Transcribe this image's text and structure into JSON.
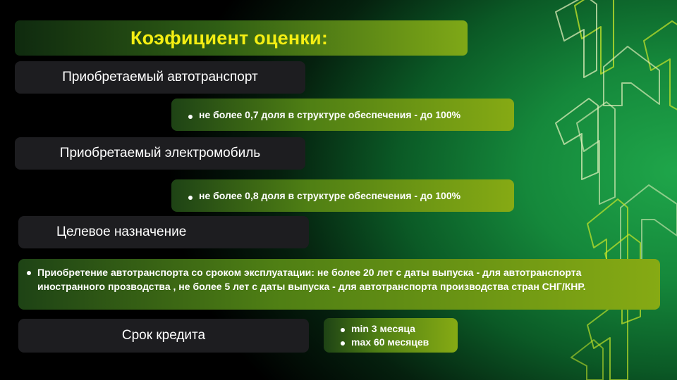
{
  "slide": {
    "title": "Коэфициент оценки:",
    "sections": [
      {
        "label": "Приобретаемый автотранспорт",
        "bullets": [
          "не более 0,7 доля в структуре обеспечения - до 100%"
        ]
      },
      {
        "label": "Приобретаемый электромобиль",
        "bullets": [
          "не более 0,8 доля в структуре обеспечения - до 100%"
        ]
      },
      {
        "label": "Целевое назначение",
        "bullets": [
          "Приобретение автотранспорта со сроком эксплуатации: не более 20 лет с даты выпуска - для автотранспорта иностранного прозводства , не более 5 лет с даты выпуска - для автотранспорта производства стран СНГ/КНР."
        ]
      },
      {
        "label": "Срок кредита",
        "bullets": [
          "min 3 месяца",
          "max 60 месяцев"
        ]
      }
    ],
    "decoration": {
      "icon": "rising-arrows-icon",
      "stroke_color": "#b8f03a"
    },
    "colors": {
      "title_text": "#f4ee13",
      "label_box": "#1d1d20",
      "info_box_start": "#1e4315",
      "info_box_end": "#86aa14"
    }
  }
}
